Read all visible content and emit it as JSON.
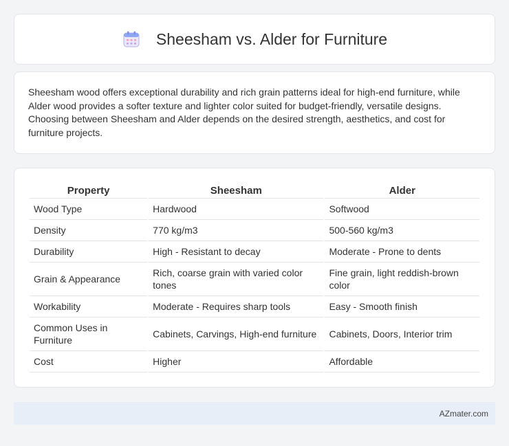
{
  "header": {
    "title": "Sheesham vs. Alder for Furniture",
    "icon": "calendar-icon"
  },
  "intro": {
    "text": "Sheesham wood offers exceptional durability and rich grain patterns ideal for high-end furniture, while Alder wood provides a softer texture and lighter color suited for budget-friendly, versatile designs. Choosing between Sheesham and Alder depends on the desired strength, aesthetics, and cost for furniture projects."
  },
  "table": {
    "headers": [
      "Property",
      "Sheesham",
      "Alder"
    ],
    "rows": [
      [
        "Wood Type",
        "Hardwood",
        "Softwood"
      ],
      [
        "Density",
        "770 kg/m3",
        "500-560 kg/m3"
      ],
      [
        "Durability",
        "High - Resistant to decay",
        "Moderate - Prone to dents"
      ],
      [
        "Grain & Appearance",
        "Rich, coarse grain with varied color tones",
        "Fine grain, light reddish-brown color"
      ],
      [
        "Workability",
        "Moderate - Requires sharp tools",
        "Easy - Smooth finish"
      ],
      [
        "Common Uses in Furniture",
        "Cabinets, Carvings, High-end furniture",
        "Cabinets, Doors, Interior trim"
      ],
      [
        "Cost",
        "Higher",
        "Affordable"
      ]
    ]
  },
  "footer": {
    "brand": "AZmater.com"
  }
}
